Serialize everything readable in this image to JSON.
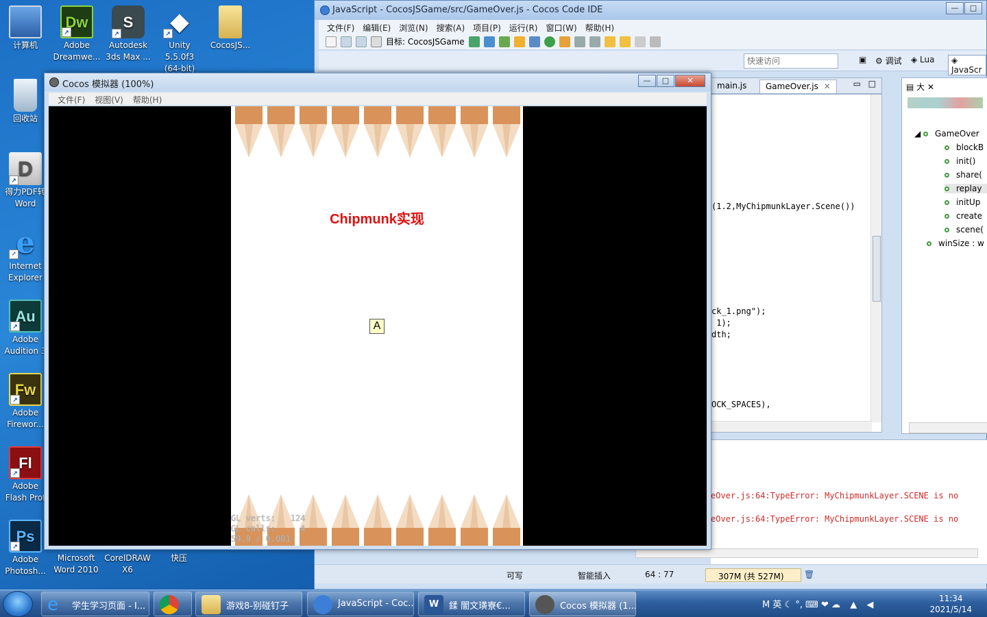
{
  "desktop": {
    "icons": [
      {
        "line1": "计算机",
        "line2": ""
      },
      {
        "line1": "Adobe",
        "line2": "Dreamwe...",
        "badge": "Dw"
      },
      {
        "line1": "Autodesk",
        "line2": "3ds Max ..."
      },
      {
        "line1": "Unity 5.5.0f3",
        "line2": "(64-bit)"
      },
      {
        "line1": "CocosJS...",
        "line2": ""
      },
      {
        "line1": "回收站",
        "line2": ""
      },
      {
        "line1": "得力PDF转",
        "line2": "Word"
      },
      {
        "line1": "Internet",
        "line2": "Explorer"
      },
      {
        "line1": "Adobe",
        "line2": "Audition 3",
        "badge": "Au"
      },
      {
        "line1": "Adobe",
        "line2": "Firewor...",
        "badge": "Fw"
      },
      {
        "line1": "Adobe",
        "line2": "Flash Prof",
        "badge": "Fl"
      },
      {
        "line1": "Adobe",
        "line2": "Photosh...",
        "badge": "Ps"
      },
      {
        "line1": "Microsoft",
        "line2": "Word 2010"
      },
      {
        "line1": "CorelDRAW",
        "line2": "X6"
      },
      {
        "line1": "快压",
        "line2": ""
      }
    ]
  },
  "ide": {
    "title": "JavaScript - CocosJSGame/src/GameOver.js - Cocos Code IDE",
    "menu": [
      "文件(F)",
      "编辑(E)",
      "浏览(N)",
      "搜索(A)",
      "项目(P)",
      "运行(R)",
      "窗口(W)",
      "帮助(H)"
    ],
    "target_label": "目标: CocosJSGame",
    "quick_access_placeholder": "快速访问",
    "perspectives": {
      "debug": "调试",
      "lua": "Lua",
      "javascript": "JavaScr"
    },
    "tabs": {
      "main": "main.js",
      "gameover": "GameOver.js"
    },
    "code_lines": [
      {
        "text": "(1.2,MyChipmunkLayer.Scene())"
      },
      {
        "text": "ck_1.png\");"
      },
      {
        "text": " 1);"
      },
      {
        "text": "dth;"
      },
      {
        "text": "OCK_SPACES),"
      }
    ],
    "outline": {
      "tab_label": "大",
      "root": "GameOver",
      "items": [
        "blockB",
        "init()",
        "share(",
        "replay",
        "initUp",
        "create",
        "scene("
      ],
      "extra": "winSize : w"
    },
    "console": {
      "errors": [
        "eOver.js:64:TypeError: MyChipmunkLayer.SCENE is no",
        "eOver.js:64:TypeError: MyChipmunkLayer.SCENE is no"
      ]
    },
    "status": {
      "writable": "可写",
      "insert": "智能插入",
      "position": "64 : 77",
      "memory": "307M (共 527M)"
    }
  },
  "simulator": {
    "title": "Cocos 模拟器 (100%)",
    "menu": [
      "文件(F)",
      "视图(V)",
      "帮助(H)"
    ],
    "game_title": "Chipmunk实现",
    "key_label": "A",
    "stats": {
      "line1": "GL verts:   124",
      "line2": "GL calls:     4",
      "line3": "59.9 / 0.001"
    }
  },
  "taskbar": {
    "buttons": [
      {
        "label": "学生学习页面 - I..."
      },
      {
        "label": ""
      },
      {
        "label": "游戏8-别碰钉子"
      },
      {
        "label": "JavaScript - Coc..."
      },
      {
        "label": "鍒    闇文璜寮€..."
      },
      {
        "label": "Cocos 模拟器 (1..."
      }
    ],
    "tray_lang": "英",
    "time": "11:34",
    "date": "2021/5/14"
  },
  "colors": {
    "game_title": "#e01010",
    "error_text": "#d12a2a",
    "pencil_body": "#d9935a",
    "pencil_wood": "#f3dcc2"
  }
}
